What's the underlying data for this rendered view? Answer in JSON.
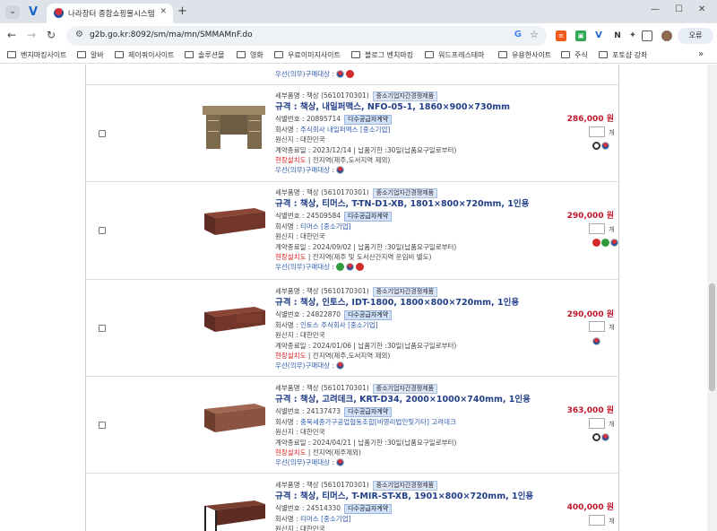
{
  "browser": {
    "tab_title": "나라장터 종합쇼핑몰시스템",
    "url": "g2b.go.kr:8092/sm/ma/mn/SMMAMnF.do",
    "profile_button": "오류",
    "bookmarks": [
      "벤치마킹사이트",
      "알바",
      "제이쿼이사이트",
      "솔루션몰",
      "영화",
      "우료이미지사이트",
      "블로그 벤치마킹",
      "워드프레스테마",
      "유용한사이트",
      "주식",
      "포토샵 강좌"
    ]
  },
  "labels": {
    "detail_prefix": "세부품명 : 책상",
    "detail_code": "(5610170301)",
    "sme_tag": "중소기업자간경쟁제품",
    "multi_tag": "다수공급자계약",
    "id_prefix": "식별번호 : ",
    "company_prefix": "회사명 : ",
    "origin": "원산지 : 대한민국",
    "install_label": "현장설치도",
    "priority_label": "우선(의무)구매대상 :",
    "qty_unit": "개"
  },
  "top_partial": {
    "priority": "우선(의무)구매대상 :"
  },
  "products": [
    {
      "name": "규격 : 책상, 내일퍼맥스, NFO-05-1, 1860×900×730mm",
      "id": "20895714",
      "company": "주식회사 내일퍼맥스",
      "company_tag": "[중소기업]",
      "contract": "계약종료일 : 2023/12/14 | 납품기한 :30일(납품요구일로부터)",
      "install": "전지역(제주,도서지역 제외)",
      "price": "286,000 원"
    },
    {
      "name": "규격 : 책상, 티머스, T-TN-D1-XB, 1801×800×720mm, 1인용",
      "id": "24509584",
      "company": "티머스",
      "company_tag": "[중소기업]",
      "contract": "계약종료일 : 2024/09/02 | 납품기한 :30일(납품요구일로부터)",
      "install": "전지역(제주 및 도서산간지역 운임비 별도)",
      "price": "290,000 원"
    },
    {
      "name": "규격 : 책상, 인토스, IDT-1800, 1800×800×720mm, 1인용",
      "id": "24822870",
      "company": "인토스 주식회사",
      "company_tag": "[중소기업]",
      "contract": "계약종료일 : 2024/01/06 | 납품기한 :30일(납품요구일로부터)",
      "install": "전지역(제주,도서지역 제외)",
      "price": "290,000 원"
    },
    {
      "name": "규격 : 책상, 고려데크, KRT-D34, 2000×1000×740mm, 1인용",
      "id": "24137473",
      "company": "충북세종가구공업협동조합",
      "company_tag": "[비영리법인및기타]",
      "company_extra": "고려데크",
      "contract": "계약종료일 : 2024/04/21 | 납품기한 :30일(납품요구일로부터)",
      "install": "전지역(제주제외)",
      "price": "363,000 원"
    },
    {
      "name": "규격 : 책상, 티머스, T-MIR-ST-XB, 1901×800×720mm, 1인용",
      "id": "24514330",
      "company": "티머스",
      "company_tag": "[중소기업]",
      "price": "400,000 원"
    }
  ]
}
